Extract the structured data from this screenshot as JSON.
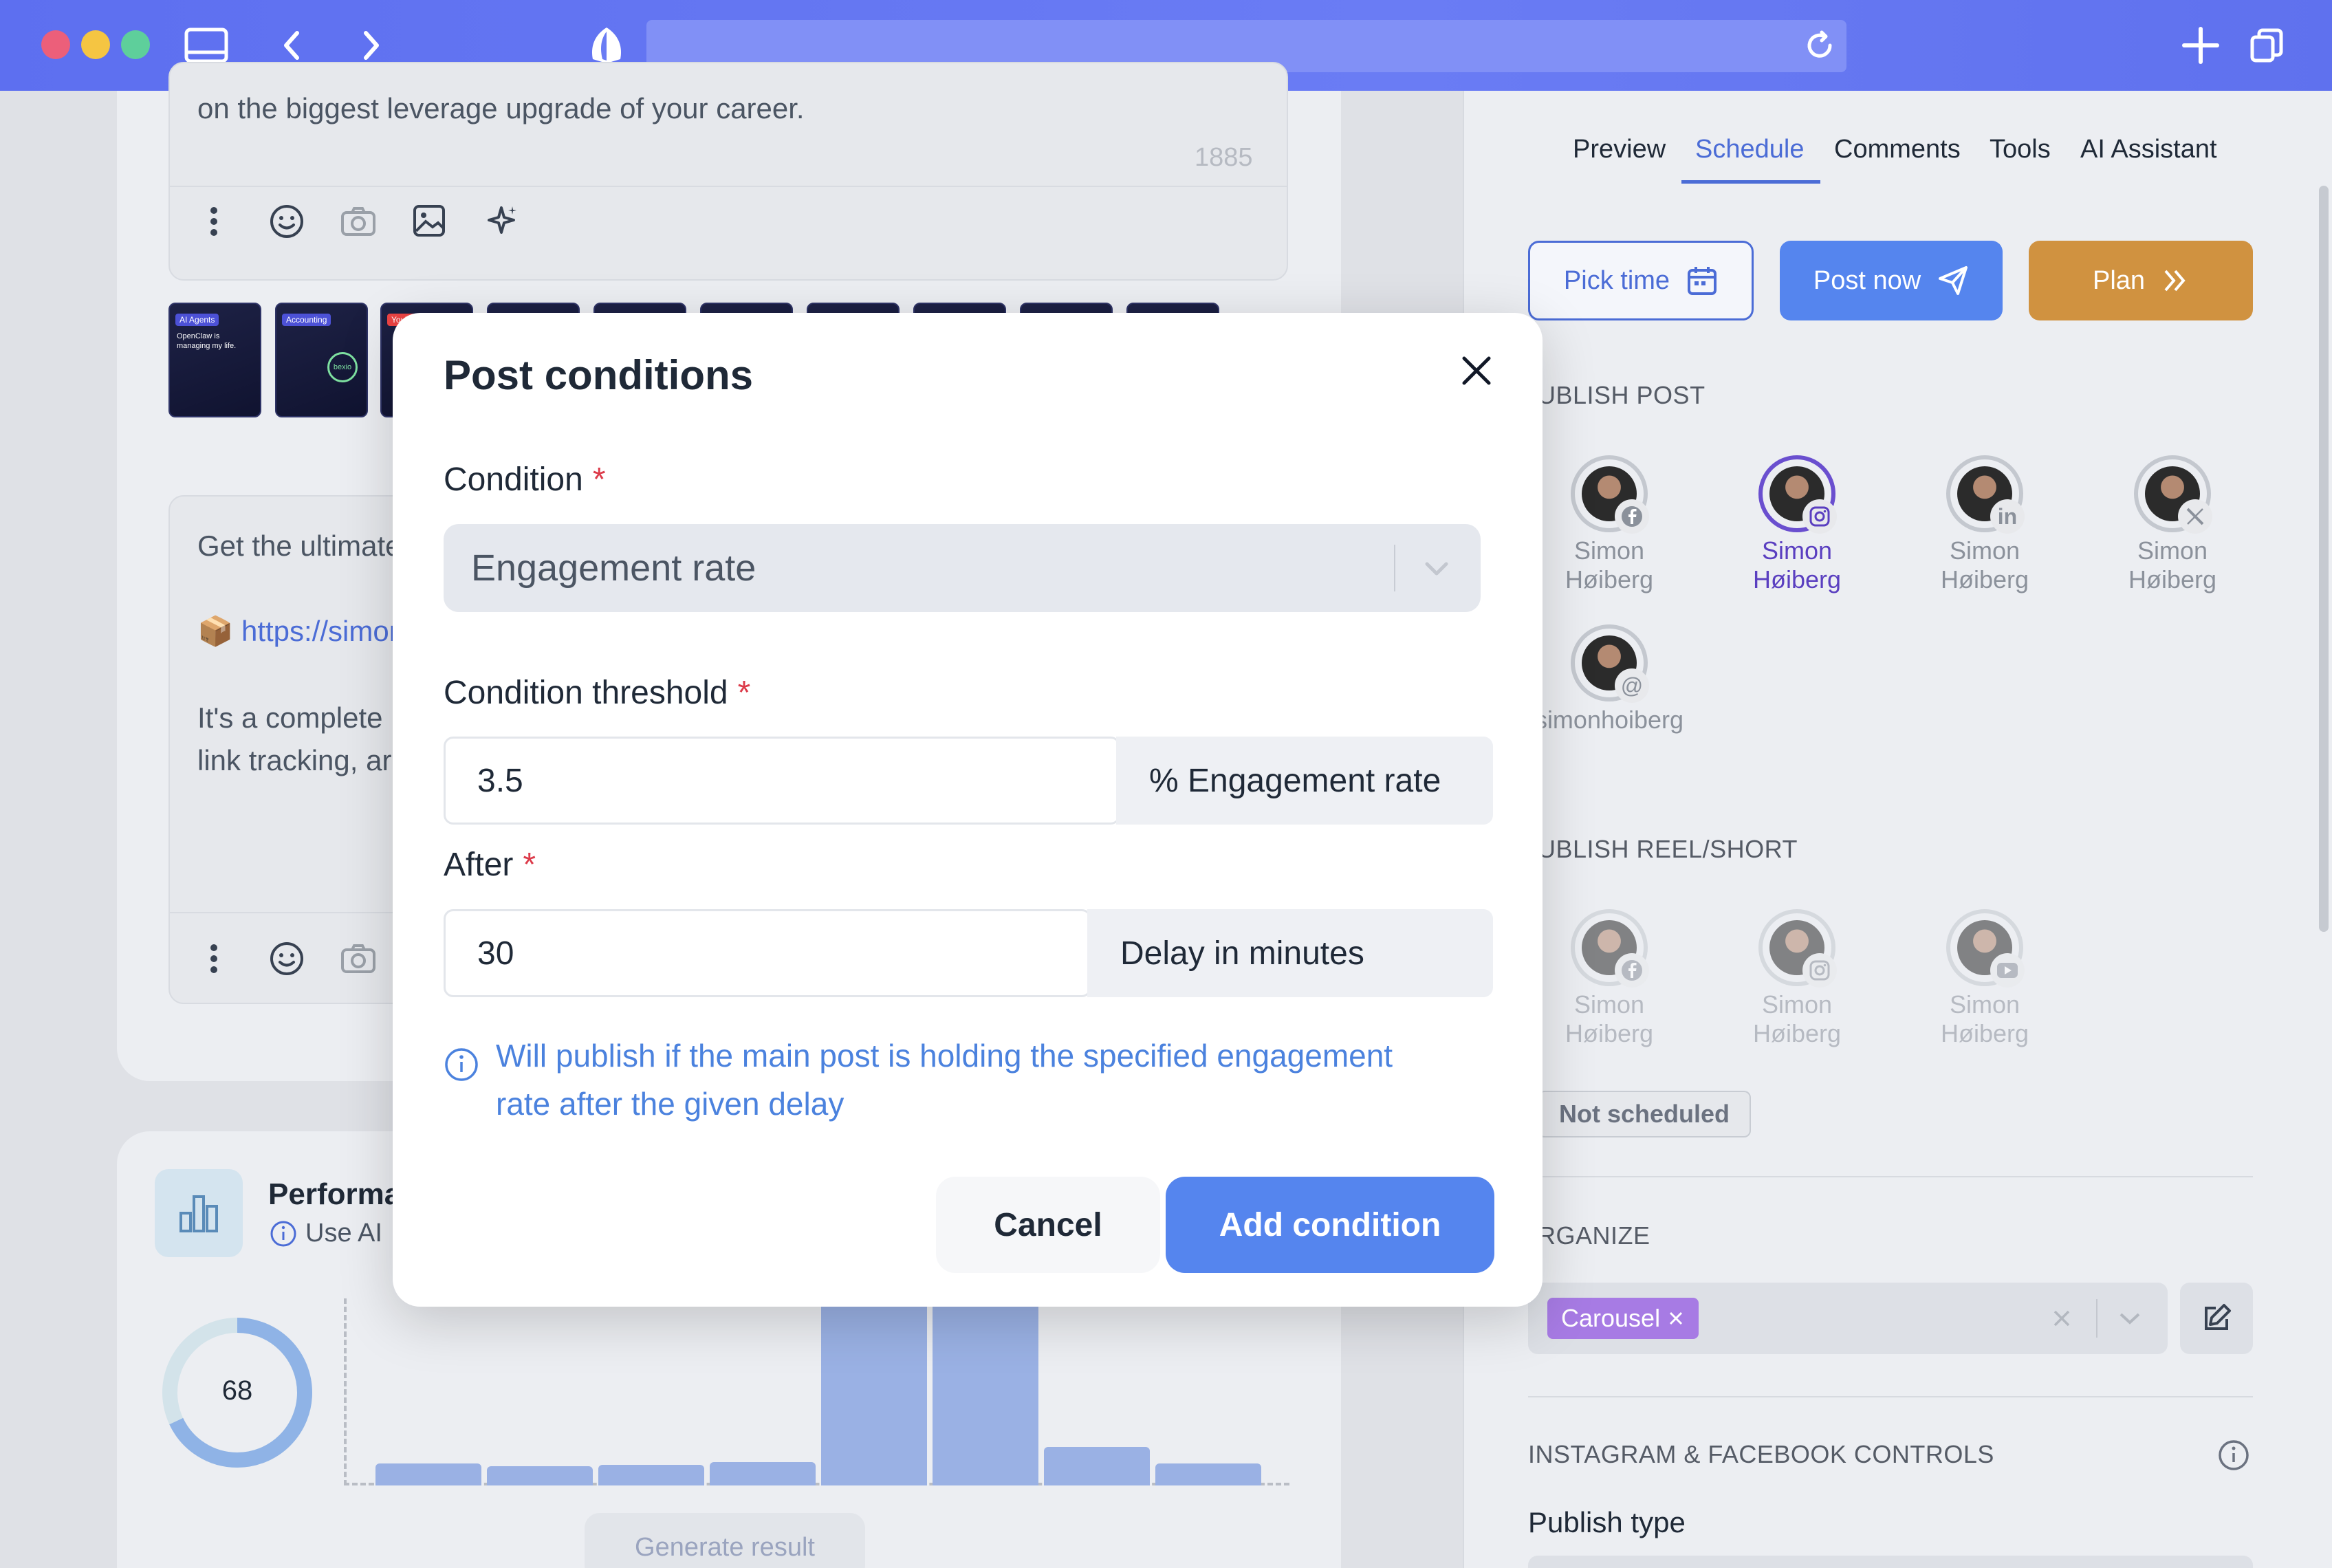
{
  "browser": {
    "traffic_lights": [
      "#ec5f7a",
      "#f5c542",
      "#5ecf9b"
    ]
  },
  "editor": {
    "first_post_tail": "on the biggest leverage upgrade of your career.",
    "char_count": "1885",
    "second_post_line1": "Get the ultimate",
    "second_post_link": "https://simon",
    "second_post_line3": "It's a complete",
    "second_post_line4": "link tracking, ar",
    "thumb_labels": [
      "AI Agents",
      "Accounting",
      "YouTube"
    ],
    "thumb_caption_1": "OpenClaw is managing my life.",
    "thumb_caption_2": "bexio"
  },
  "performance": {
    "title": "Performa",
    "subtitle": "Use AI",
    "score": "68",
    "score_fraction": 0.68,
    "generate_label": "Generate result"
  },
  "right": {
    "tabs": [
      "Preview",
      "Schedule",
      "Comments",
      "Tools",
      "AI Assistant"
    ],
    "pick_time": "Pick time",
    "post_now": "Post now",
    "plan": "Plan",
    "publish_post_heading": "UBLISH POST",
    "accounts": [
      {
        "name": "Simon Høiberg",
        "platform": "facebook"
      },
      {
        "name": "Simon Høiberg",
        "platform": "instagram"
      },
      {
        "name": "Simon Høiberg",
        "platform": "linkedin"
      },
      {
        "name": "Simon Høiberg",
        "platform": "x"
      },
      {
        "name": "simonhoiberg",
        "platform": "threads"
      }
    ],
    "publish_reel_heading": "UBLISH REEL/SHORT",
    "reel_accounts": [
      {
        "name": "Simon Høiberg",
        "platform": "facebook"
      },
      {
        "name": "Simon Høiberg",
        "platform": "instagram"
      },
      {
        "name": "Simon Høiberg",
        "platform": "youtube"
      }
    ],
    "not_scheduled": "Not scheduled",
    "organize_heading": "RGANIZE",
    "tag": "Carousel",
    "ig_fb_heading": "INSTAGRAM & FACEBOOK CONTROLS",
    "publish_type_label": "Publish type"
  },
  "modal": {
    "title": "Post conditions",
    "condition_label": "Condition",
    "condition_value": "Engagement rate",
    "threshold_label": "Condition threshold",
    "threshold_value": "3.5",
    "threshold_unit": "% Engagement rate",
    "after_label": "After",
    "after_value": "30",
    "after_unit": "Delay in minutes",
    "info_text": "Will publish if the main post is holding the specified engagement rate after the given delay",
    "cancel_label": "Cancel",
    "add_label": "Add condition",
    "required_marker": "*"
  },
  "colors": {
    "accent": "#4b6cd6",
    "primary_button": "#5585ee",
    "plan_button": "#d09240",
    "required": "#dc3b4a",
    "info": "#4b82de",
    "tag": "#a77be4"
  }
}
